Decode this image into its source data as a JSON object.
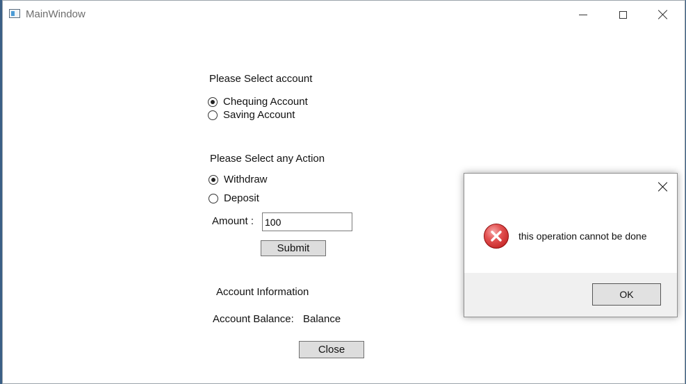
{
  "window": {
    "title": "MainWindow",
    "icon": "app-window-icon",
    "controls": [
      "minimize-icon",
      "maximize-icon",
      "close-icon"
    ]
  },
  "account": {
    "heading": "Please Select account",
    "options": [
      {
        "label": "Chequing Account",
        "checked": true
      },
      {
        "label": "Saving Account",
        "checked": false
      }
    ]
  },
  "action": {
    "heading": "Please Select any Action",
    "options": [
      {
        "label": "Withdraw",
        "checked": true
      },
      {
        "label": "Deposit",
        "checked": false
      }
    ]
  },
  "amount": {
    "label": "Amount :",
    "value": "100"
  },
  "submit_label": "Submit",
  "info": {
    "heading": "Account Information",
    "balance_label": "Account Balance:",
    "balance_value": "Balance"
  },
  "close_label": "Close",
  "dialog": {
    "message": "this operation cannot be done",
    "ok_label": "OK",
    "icon": "error-icon"
  }
}
